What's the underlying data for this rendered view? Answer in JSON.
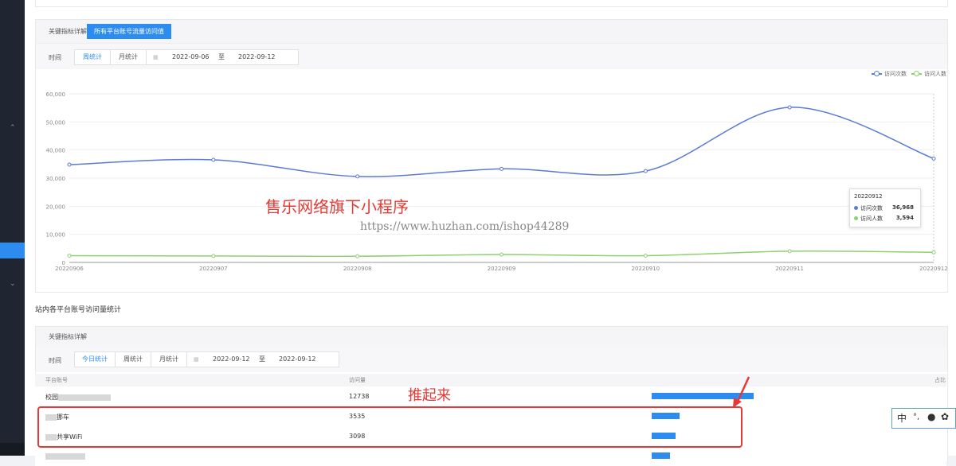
{
  "card1": {
    "head_title": "关键指标详解",
    "head_tab": "所有平台账号流量访问值",
    "filter": {
      "time_label": "时间",
      "tab_week": "周统计",
      "tab_month": "月统计",
      "start_date": "2022-09-06",
      "to_label": "至",
      "end_date": "2022-09-12"
    }
  },
  "chart_data": {
    "type": "line",
    "x": [
      "20220906",
      "20220907",
      "20220908",
      "20220909",
      "20220910",
      "20220911",
      "20220912"
    ],
    "series": [
      {
        "name": "访问次数",
        "values": [
          34800,
          36500,
          30600,
          33300,
          32500,
          55200,
          36968
        ],
        "color": "#5b7bd5"
      },
      {
        "name": "访问人数",
        "values": [
          2400,
          2300,
          2200,
          2800,
          2400,
          4000,
          3594
        ],
        "color": "#8ed16f"
      }
    ],
    "y_ticks": [
      "0",
      "10,000",
      "20,000",
      "30,000",
      "40,000",
      "50,000",
      "60,000"
    ],
    "ylim": [
      0,
      60000
    ],
    "grid": true,
    "legend_position": "top-right",
    "tooltip": {
      "date": "20220912",
      "rows": [
        {
          "label": "访问次数",
          "value": "36,968"
        },
        {
          "label": "访问人数",
          "value": "3,594"
        }
      ]
    }
  },
  "watermark": {
    "title": "售乐网络旗下小程序",
    "url": "https://www.huzhan.com/ishop44289"
  },
  "section2": {
    "title": "站内各平台账号访问量统计",
    "head_title": "关键指标详解",
    "filter": {
      "time_label": "时间",
      "tab_today": "今日统计",
      "tab_week": "周统计",
      "tab_month": "月统计",
      "start_date": "2022-09-12",
      "to_label": "至",
      "end_date": "2022-09-12"
    },
    "columns": [
      "平台账号",
      "访问量",
      "占比"
    ],
    "rows": [
      {
        "name": "校园",
        "name_suffix": "",
        "visits": "12738",
        "ratio": 0.88
      },
      {
        "name": "",
        "name_suffix": "挪车",
        "visits": "3535",
        "ratio": 0.24
      },
      {
        "name": "",
        "name_suffix": "共享WiFi",
        "visits": "3098",
        "ratio": 0.21
      },
      {
        "name": "",
        "name_suffix": "",
        "visits": "",
        "ratio": 0.16
      }
    ]
  },
  "annotation": "推起来",
  "toolbar": {
    "zh": "中",
    "punct": "°,",
    "dot": "●",
    "gear": "✿"
  }
}
